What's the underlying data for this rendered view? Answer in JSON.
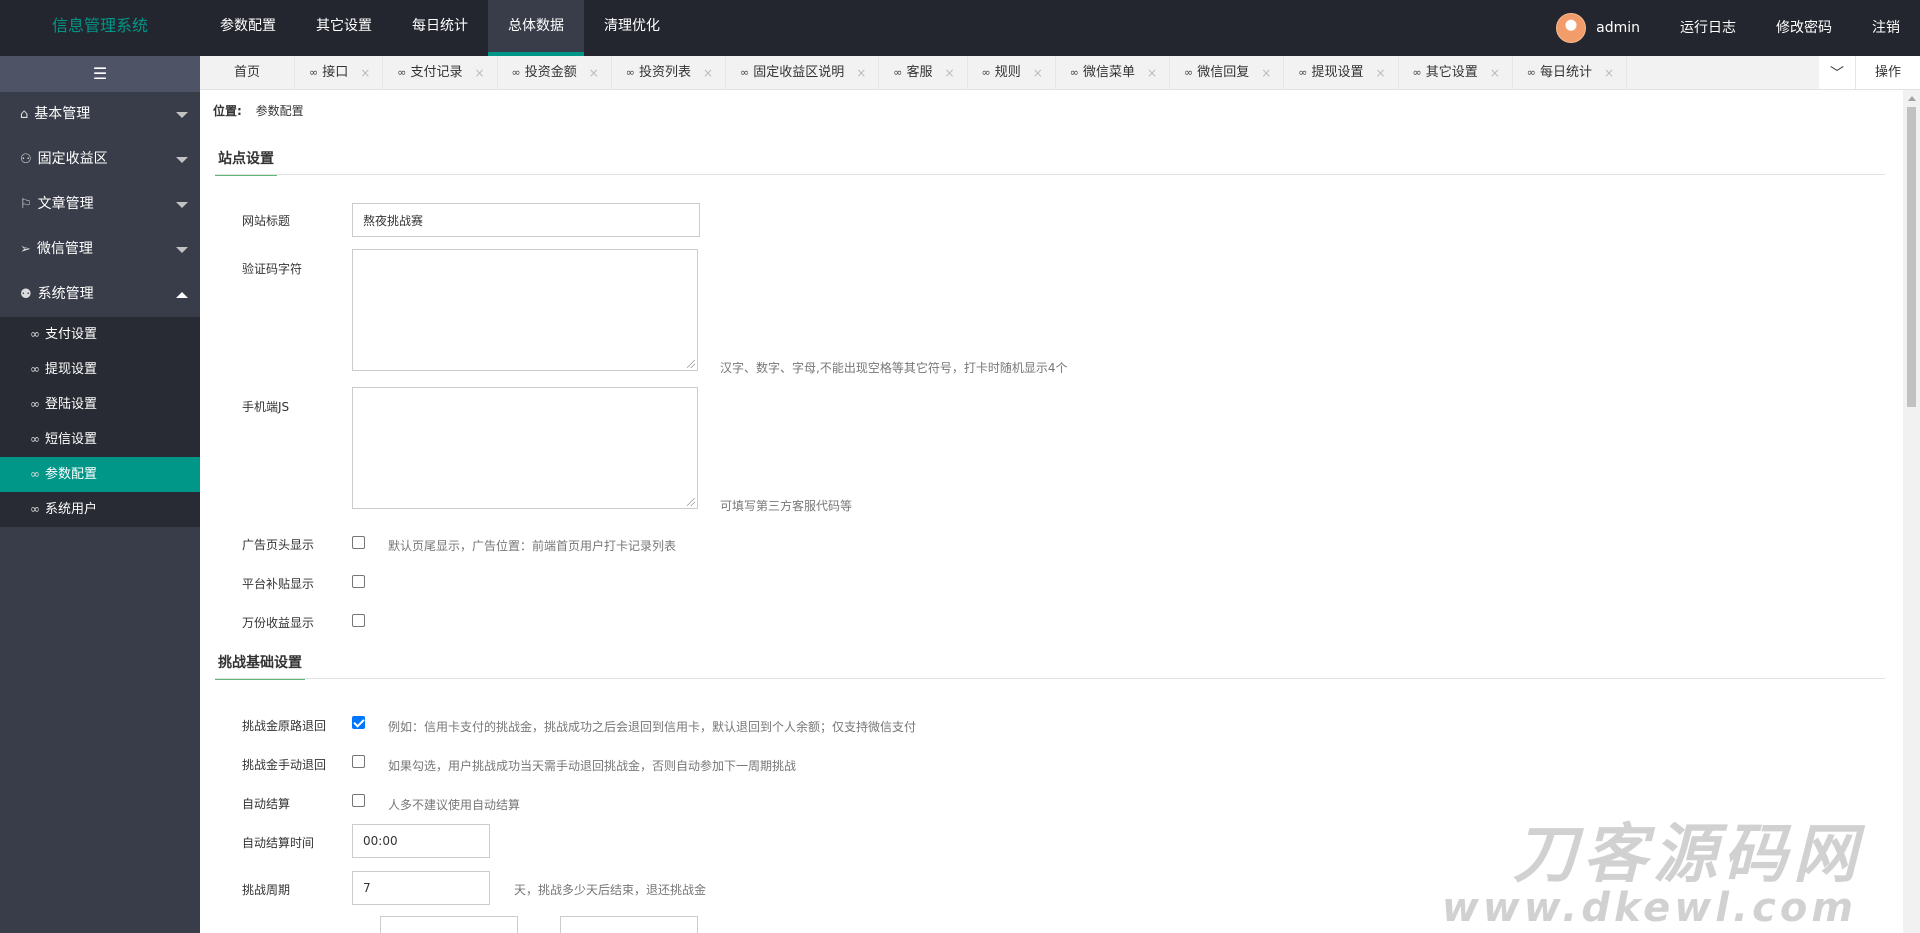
{
  "header": {
    "logo": "信息管理系统",
    "nav": [
      "参数配置",
      "其它设置",
      "每日统计",
      "总体数据",
      "清理优化"
    ],
    "active_nav": "总体数据",
    "user": "admin",
    "right": [
      "运行日志",
      "修改密码",
      "注销"
    ]
  },
  "sidebar": {
    "toggle_icon": "☰",
    "groups": [
      {
        "label": "基本管理",
        "icon": "home-icon",
        "glyph": "⌂"
      },
      {
        "label": "固定收益区",
        "icon": "users-icon",
        "glyph": "⚇"
      },
      {
        "label": "文章管理",
        "icon": "flag-icon",
        "glyph": "⚐"
      },
      {
        "label": "微信管理",
        "icon": "send-icon",
        "glyph": "➢"
      },
      {
        "label": "系统管理",
        "icon": "user-icon",
        "glyph": "⚉"
      }
    ],
    "sub_items": [
      "支付设置",
      "提现设置",
      "登陆设置",
      "短信设置",
      "参数配置",
      "系统用户"
    ],
    "active_sub": "参数配置"
  },
  "tabs": {
    "home": "首页",
    "items": [
      "接口",
      "支付记录",
      "投资金额",
      "投资列表",
      "固定收益区说明",
      "客服",
      "规则",
      "微信菜单",
      "微信回复",
      "提现设置",
      "其它设置",
      "每日统计"
    ],
    "close": "×",
    "link_glyph": "∞",
    "down_glyph": "﹀",
    "operation": "操作"
  },
  "breadcrumb": {
    "label": "位置:",
    "current": "参数配置"
  },
  "site": {
    "title": "站点设置",
    "site_title_label": "网站标题",
    "site_title_value": "熬夜挑战赛",
    "captcha_label": "验证码字符",
    "captcha_hint": "汉字、数字、字母,不能出现空格等其它符号，打卡时随机显示4个",
    "mobile_js_label": "手机端JS",
    "mobile_js_hint": "可填写第三方客服代码等",
    "ad_header_label": "广告页头显示",
    "ad_header_hint": "默认页尾显示，广告位置：前端首页用户打卡记录列表",
    "subsidy_label": "平台补贴显示",
    "wanfen_label": "万份收益显示"
  },
  "challenge": {
    "title": "挑战基础设置",
    "refund_label": "挑战金原路退回",
    "refund_hint": "例如：信用卡支付的挑战金，挑战成功之后会退回到信用卡，默认退回到个人余额；仅支持微信支付",
    "refund_checked": true,
    "manual_label": "挑战金手动退回",
    "manual_hint": "如果勾选，用户挑战成功当天需手动退回挑战金，否则自动参加下一周期挑战",
    "auto_label": "自动结算",
    "auto_hint": "人多不建议使用自动结算",
    "auto_time_label": "自动结算时间",
    "auto_time_value": "00:00",
    "period_label": "挑战周期",
    "period_value": "7",
    "period_hint": "天，挑战多少天后结束，退还挑战金"
  },
  "watermark": {
    "line1": "刀客源码网",
    "line2": "www.dkewl.com"
  }
}
